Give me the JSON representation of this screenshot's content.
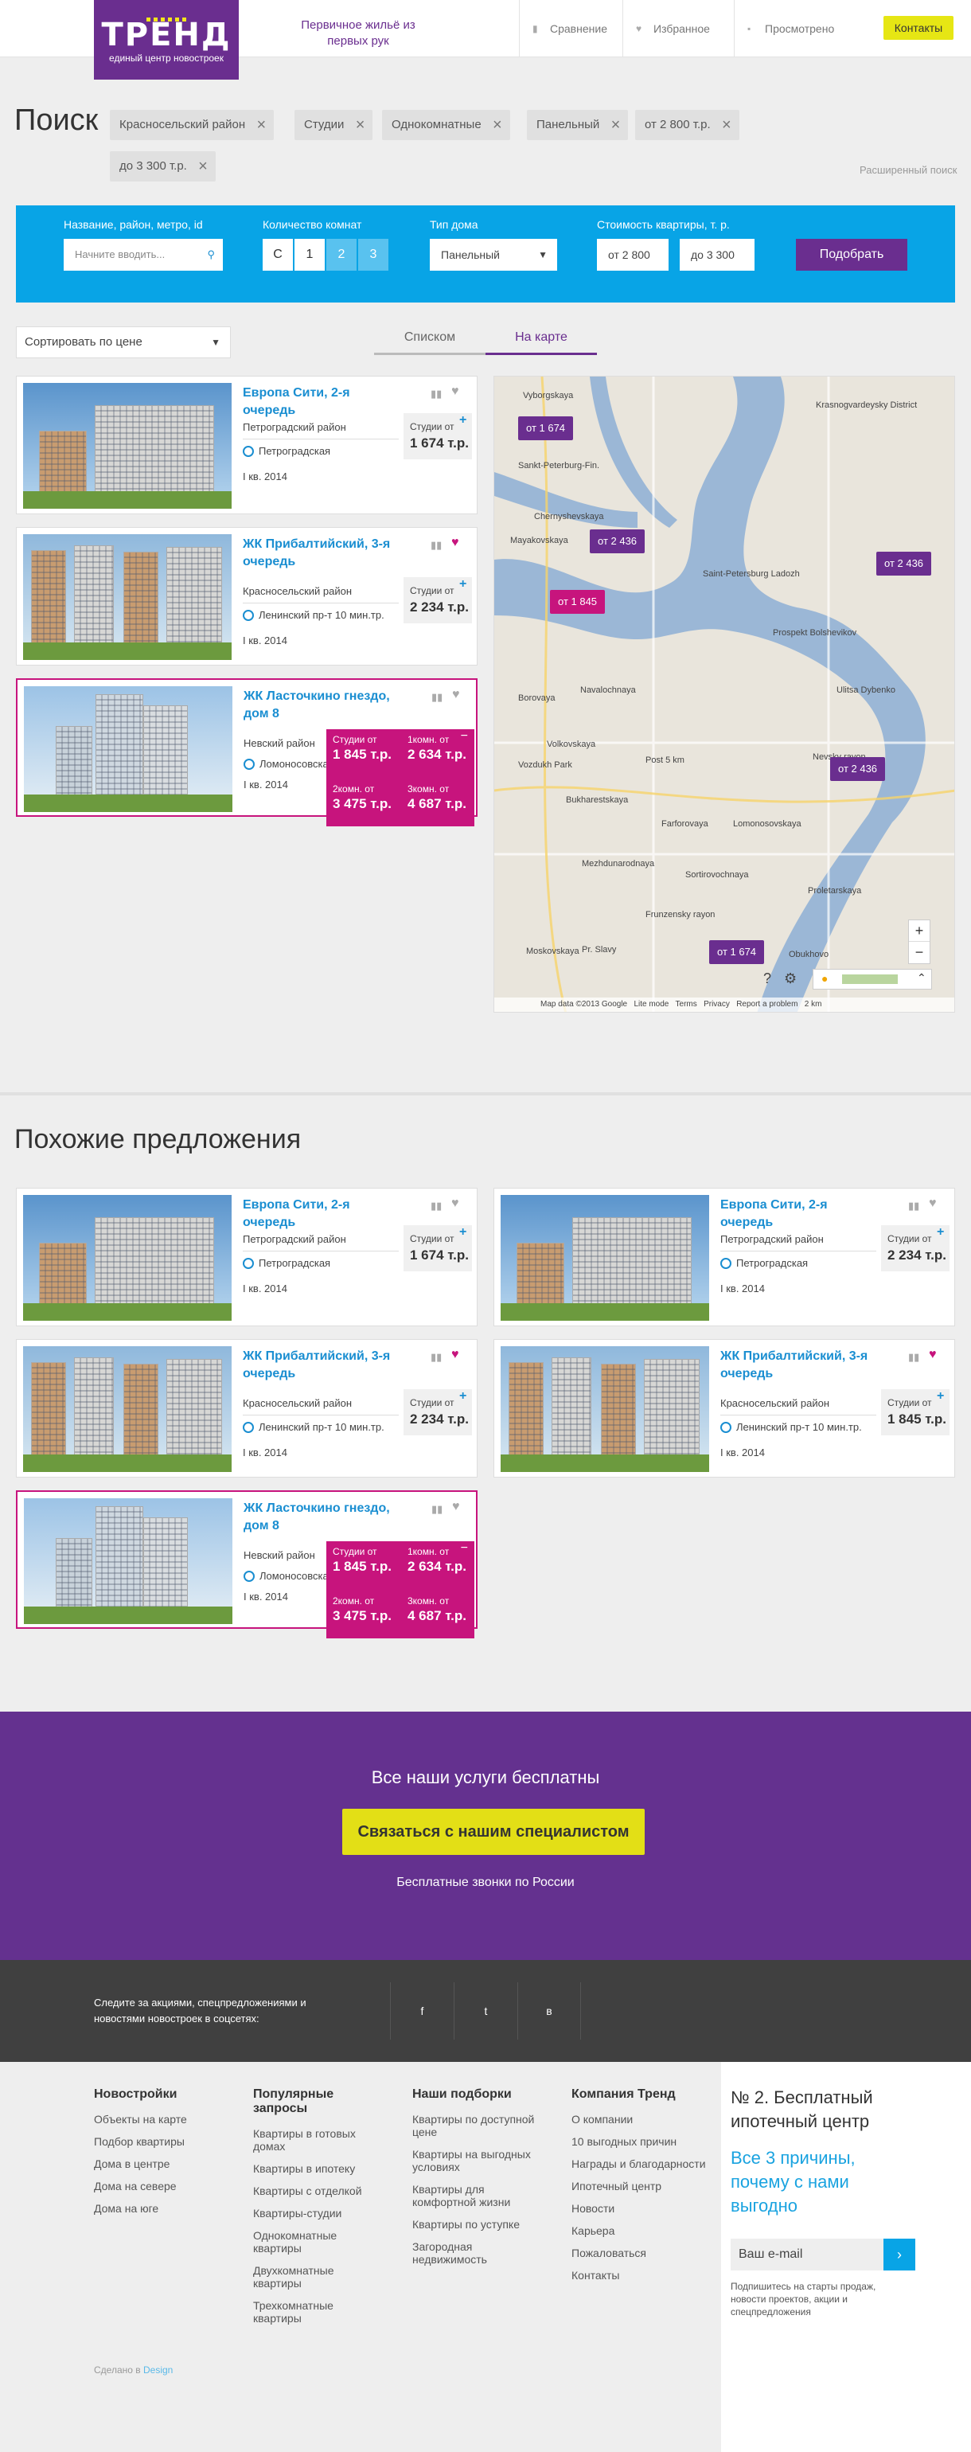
{
  "header": {
    "logo_text": "ТРЕНД",
    "logo_sub": "единый центр новостроек",
    "tagline": "Первичное жильё из первых рук",
    "nav": [
      {
        "label": "Сравнение",
        "icon": "bar-chart-icon"
      },
      {
        "label": "Избранное",
        "icon": "heart-icon"
      },
      {
        "label": "Просмотрено",
        "icon": "document-icon"
      }
    ],
    "contacts": "Контакты"
  },
  "search": {
    "title": "Поиск",
    "chips": [
      "Красносельский район",
      "Студии",
      "Однокомнатные",
      "Панельный",
      "от 2 800 т.р.",
      "до 3 300 т.р."
    ],
    "advanced": "Расширенный поиск",
    "labels": {
      "name": "Название, район, метро, id",
      "rooms": "Количество комнат",
      "house": "Тип дома",
      "price": "Стоимость квартиры, т. р."
    },
    "name_placeholder": "Начните вводить...",
    "rooms": [
      "С",
      "1",
      "2",
      "3"
    ],
    "house_value": "Панельный",
    "price_from": "от 2 800",
    "price_to": "до 3 300",
    "submit": "Подобрать"
  },
  "list": {
    "sort": "Сортировать по цене",
    "tabs": [
      "Списком",
      "На карте"
    ]
  },
  "cards": [
    {
      "name": "Европа Сити, 2-я очередь",
      "district": "Петроградский район",
      "metro": "Петроградская",
      "date": "I кв. 2014",
      "price_label": "Студии от",
      "price": "1 674 т.р."
    },
    {
      "name": "ЖК Прибалтийский, 3-я очередь",
      "district": "Красносельский район",
      "metro": "Ленинский пр-т 10 мин.тр.",
      "date": "I кв. 2014",
      "price_label": "Студии от",
      "price": "2 234 т.р."
    },
    {
      "name": "ЖК Ласточкино гнездо, дом 8",
      "district": "Невский район",
      "metro": "Ломоносовская",
      "date": "I кв. 2014",
      "prices": [
        {
          "l": "Студии от",
          "v": "1 845 т.р."
        },
        {
          "l": "1комн. от",
          "v": "2 634 т.р."
        },
        {
          "l": "2комн. от",
          "v": "3 475 т.р."
        },
        {
          "l": "3комн. от",
          "v": "4 687 т.р."
        }
      ]
    }
  ],
  "map": {
    "tags": [
      "от 1 674",
      "от 2 436",
      "от 1 845",
      "от 2 436",
      "от 2 436",
      "от 1 674"
    ],
    "labels": [
      "Krasnogvardeysky District",
      "Vyborgskaya",
      "Sankt-Peterburg-Fin.",
      "Chernyshevskaya",
      "Mayakovskaya",
      "Saint-Petersburg Ladozh",
      "Prospekt Bolshevikov",
      "Borovaya",
      "Navalochnaya",
      "Ulitsa Dybenko",
      "Volkovskaya",
      "Vozdukh Park",
      "Post 5 km",
      "Nevsky rayon",
      "Bukharestskaya",
      "Farforovaya",
      "Lomonosovskaya",
      "Mezhdunarodnaya",
      "Sortirovochnaya",
      "Proletarskaya",
      "Frunzensky rayon",
      "Moskovskaya",
      "Pr. Slavy",
      "Obukhovo"
    ],
    "credits": "Map data ©2013 Google   Lite mode   Terms   Privacy   Report a problem   2 km"
  },
  "similar": {
    "title": "Похожие предложения",
    "cards": [
      {
        "name": "Европа Сити, 2-я очередь",
        "district": "Петроградский район",
        "metro": "Петроградская",
        "date": "I кв. 2014",
        "price_label": "Студии от",
        "price": "1 674 т.р."
      },
      {
        "name": "Европа Сити, 2-я очередь",
        "district": "Петроградский район",
        "metro": "Петроградская",
        "date": "I кв. 2014",
        "price_label": "Студии от",
        "price": "2 234 т.р."
      },
      {
        "name": "ЖК Прибалтийский, 3-я очередь",
        "district": "Красносельский район",
        "metro": "Ленинский пр-т 10 мин.тр.",
        "date": "I кв. 2014",
        "price_label": "Студии от",
        "price": "2 234 т.р."
      },
      {
        "name": "ЖК Прибалтийский, 3-я очередь",
        "district": "Красносельский район",
        "metro": "Ленинский пр-т 10 мин.тр.",
        "date": "I кв. 2014",
        "price_label": "Студии от",
        "price": "1 845 т.р."
      },
      {
        "name": "ЖК Ласточкино гнездо, дом 8",
        "district": "Невский район",
        "metro": "Ломоносовская",
        "date": "I кв. 2014",
        "prices": [
          {
            "l": "Студии от",
            "v": "1 845 т.р."
          },
          {
            "l": "1комн. от",
            "v": "2 634 т.р."
          },
          {
            "l": "2комн. от",
            "v": "3 475 т.р."
          },
          {
            "l": "3комн. от",
            "v": "4 687 т.р."
          }
        ]
      }
    ]
  },
  "cta": {
    "title": "Все наши услуги бесплатны",
    "button": "Связаться с нашим специалистом",
    "sub": "Бесплатные звонки по России"
  },
  "social": {
    "text": "Следите за акциями, спецпредложениями и новостями новостроек в соцсетях:",
    "buttons": [
      "f",
      "t",
      "в"
    ]
  },
  "footer": {
    "cols": [
      {
        "title": "Новостройки",
        "items": [
          "Объекты на карте",
          "Подбор квартиры",
          "Дома в центре",
          "Дома на севере",
          "Дома на юге"
        ]
      },
      {
        "title": "Популярные запросы",
        "items": [
          "Квартиры в готовых домах",
          "Квартиры в ипотеку",
          "Квартиры с отделкой",
          "Квартиры-студии",
          "Однокомнатные квартиры",
          "Двухкомнатные квартиры",
          "Трехкомнатные квартиры"
        ]
      },
      {
        "title": "Наши подборки",
        "items": [
          "Квартиры по доступной цене",
          "Квартиры на выгодных условиях",
          "Квартиры для комфортной жизни",
          "Квартиры по уступке",
          "Загородная недвижимость"
        ]
      },
      {
        "title": "Компания Тренд",
        "items": [
          "О компании",
          "10 выгодных причин",
          "Награды и благодарности",
          "Ипотечный центр",
          "Новости",
          "Карьера",
          "Пожаловаться",
          "Контакты"
        ]
      }
    ],
    "side_title": "№ 2. Бесплатный ипотечный центр",
    "side_link": "Все 3 причины, почему с нами выгодно",
    "email_placeholder": "Ваш e-mail",
    "note": "Подпишитесь на старты продаж, новости проектов, акции и спецпредложения",
    "made": "Сделано в",
    "made_link": "Design"
  }
}
